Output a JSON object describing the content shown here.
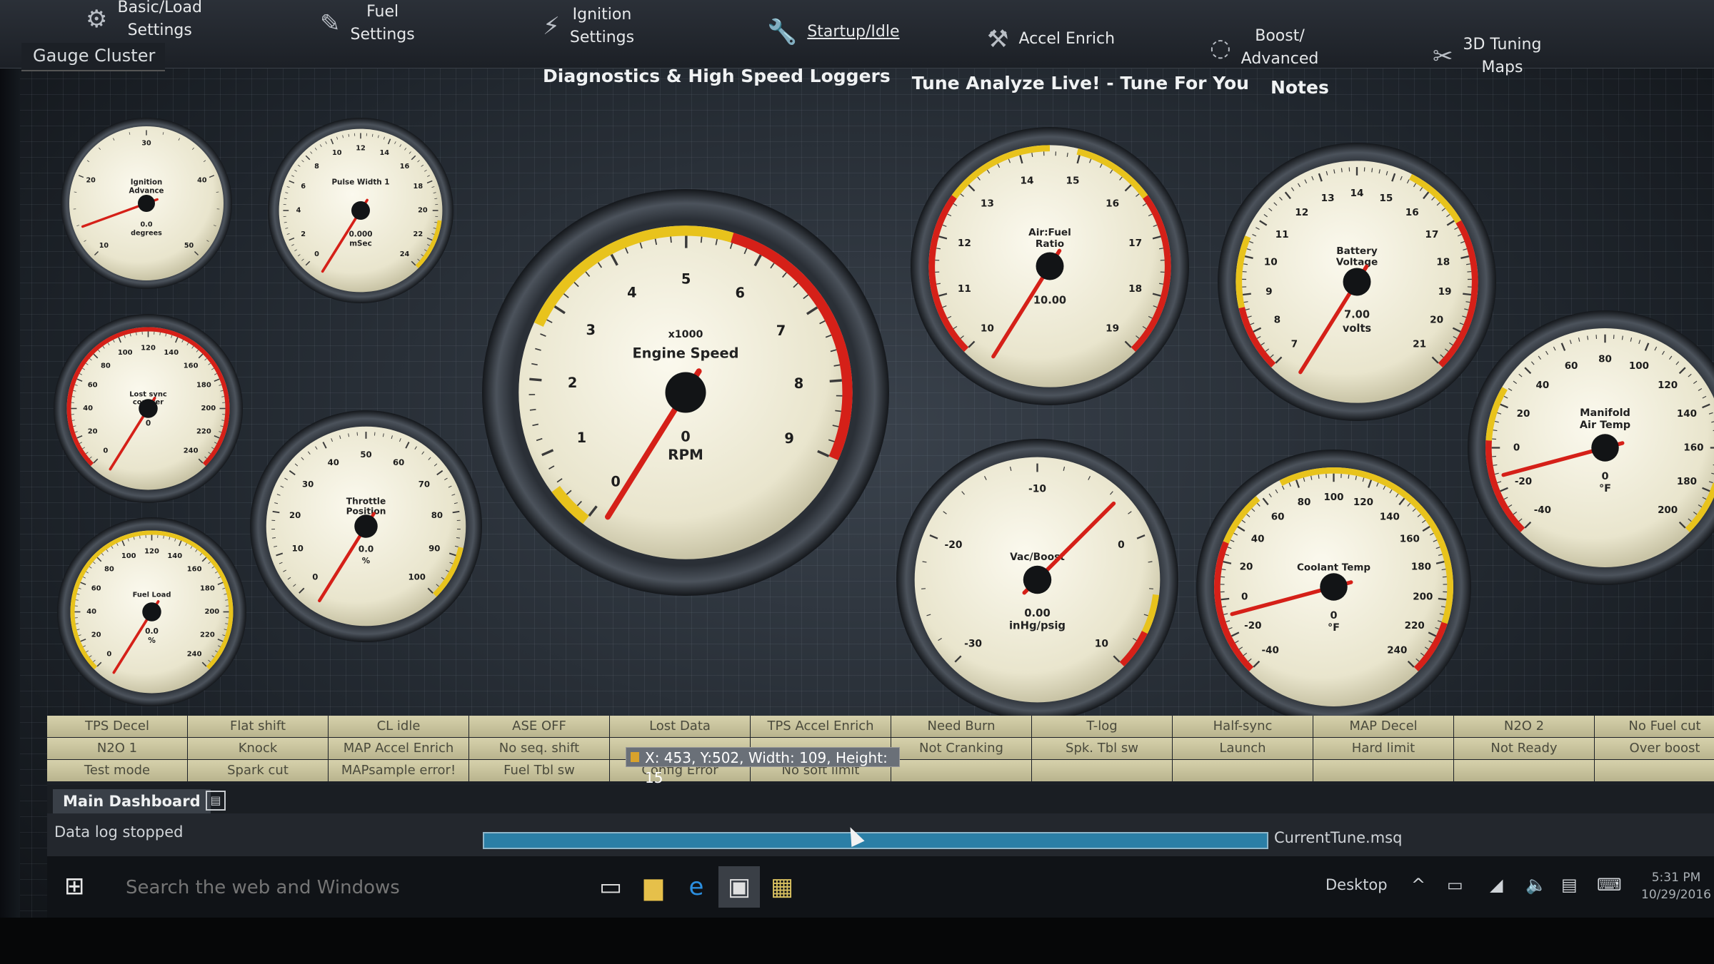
{
  "menu": {
    "items": [
      {
        "label": "Basic/Load\nSettings",
        "icon": "gear-icon"
      },
      {
        "label": "Fuel\nSettings",
        "icon": "fuel-injector-icon"
      },
      {
        "label": "Ignition\nSettings",
        "icon": "spark-plug-icon"
      },
      {
        "label": "Startup/Idle",
        "icon": "wrench-icon"
      },
      {
        "label": "Accel Enrich",
        "icon": "tools-icon"
      },
      {
        "label": "Boost/\nAdvanced",
        "icon": "turbo-icon"
      },
      {
        "label": "3D Tuning\nMaps",
        "icon": "wrench-screwdriver-icon"
      }
    ],
    "tab_label": "Gauge Cluster",
    "submenu": [
      "Diagnostics & High Speed Loggers",
      "Tune Analyze Live! - Tune For You",
      "Notes"
    ]
  },
  "gauges": {
    "ignition": {
      "title": [
        "Ignition",
        "Advance"
      ],
      "ticks": [
        "10",
        "20",
        "30",
        "40",
        "50"
      ],
      "value": "0.0",
      "unit": "degrees"
    },
    "pulse": {
      "title": [
        "Pulse Width 1"
      ],
      "ticks": [
        "0",
        "2",
        "4",
        "6",
        "8",
        "10",
        "12",
        "14",
        "16",
        "18",
        "20",
        "22",
        "24"
      ],
      "value": "0.000",
      "unit": "mSec"
    },
    "rpm": {
      "title": [
        "x1000",
        "Engine Speed"
      ],
      "ticks": [
        "0",
        "1",
        "2",
        "3",
        "4",
        "5",
        "6",
        "7",
        "8",
        "9"
      ],
      "value": "0",
      "unit": "RPM"
    },
    "afr": {
      "title": [
        "Air:Fuel",
        "Ratio"
      ],
      "ticks": [
        "10",
        "11",
        "12",
        "13",
        "14",
        "15",
        "16",
        "17",
        "18",
        "19"
      ],
      "value": "10.00",
      "unit": ""
    },
    "battery": {
      "title": [
        "Battery",
        "Voltage"
      ],
      "ticks": [
        "7",
        "8",
        "9",
        "10",
        "11",
        "12",
        "13",
        "14",
        "15",
        "16",
        "17",
        "18",
        "19",
        "20",
        "21"
      ],
      "value": "7.00",
      "unit": "volts"
    },
    "lostsync": {
      "title": [
        "Lost sync",
        "counter"
      ],
      "ticks": [
        "0",
        "20",
        "40",
        "60",
        "80",
        "100",
        "120",
        "140",
        "160",
        "180",
        "200",
        "220",
        "240"
      ],
      "value": "0",
      "unit": ""
    },
    "throttle": {
      "title": [
        "Throttle",
        "Position"
      ],
      "ticks": [
        "0",
        "10",
        "20",
        "30",
        "40",
        "50",
        "60",
        "70",
        "80",
        "90",
        "100"
      ],
      "value": "0.0",
      "unit": "%"
    },
    "fuelload": {
      "title": [
        "Fuel Load"
      ],
      "ticks": [
        "0",
        "20",
        "40",
        "60",
        "80",
        "100",
        "120",
        "140",
        "160",
        "180",
        "200",
        "220",
        "240"
      ],
      "value": "0.0",
      "unit": "%"
    },
    "vacboost": {
      "title": [
        "Vac/Boost"
      ],
      "ticks": [
        "-30",
        "-20",
        "-10",
        "0",
        "10"
      ],
      "value": "0.00",
      "unit": "inHg/psig"
    },
    "coolant": {
      "title": [
        "Coolant Temp"
      ],
      "ticks": [
        "-40",
        "-20",
        "0",
        "20",
        "40",
        "60",
        "80",
        "100",
        "120",
        "140",
        "160",
        "180",
        "200",
        "220",
        "240"
      ],
      "value": "0",
      "unit": "°F"
    },
    "manifold": {
      "title": [
        "Manifold",
        "Air Temp"
      ],
      "ticks": [
        "-40",
        "-20",
        "0",
        "20",
        "40",
        "60",
        "80",
        "100",
        "120",
        "140",
        "160",
        "180",
        "200"
      ],
      "value": "0",
      "unit": "°F"
    }
  },
  "indicators": [
    [
      "TPS Decel",
      "Flat shift",
      "CL idle",
      "ASE OFF",
      "Lost Data",
      "TPS Accel Enrich",
      "Need Burn",
      "T-log",
      "Half-sync",
      "MAP Decel",
      "N2O 2",
      "No Fuel cut"
    ],
    [
      "N2O 1",
      "Knock",
      "MAP Accel Enrich",
      "No seq. shift",
      "",
      "",
      "Not Cranking",
      "Spk. Tbl sw",
      "Launch",
      "Hard limit",
      "Not Ready",
      "Over boost"
    ],
    [
      "Test mode",
      "Spark cut",
      "MAPsample error!",
      "Fuel Tbl sw",
      "Config Error",
      "No soft limit",
      "",
      "",
      "",
      "",
      "",
      ""
    ]
  ],
  "coord_readout": "X: 453, Y:502, Width: 109, Height: 15",
  "tabs": {
    "main": "Main Dashboard"
  },
  "status": {
    "text": "Data log stopped",
    "tune_file": "CurrentTune.msq",
    "progress_fraction": 1.0
  },
  "taskbar": {
    "search_placeholder": "Search the web and Windows",
    "desktop": "Desktop",
    "time": "5:31 PM",
    "date": "10/29/2016"
  },
  "colors": {
    "accent_red": "#d52018",
    "accent_yellow": "#e8c31c",
    "gauge_face": "#efecd8"
  }
}
